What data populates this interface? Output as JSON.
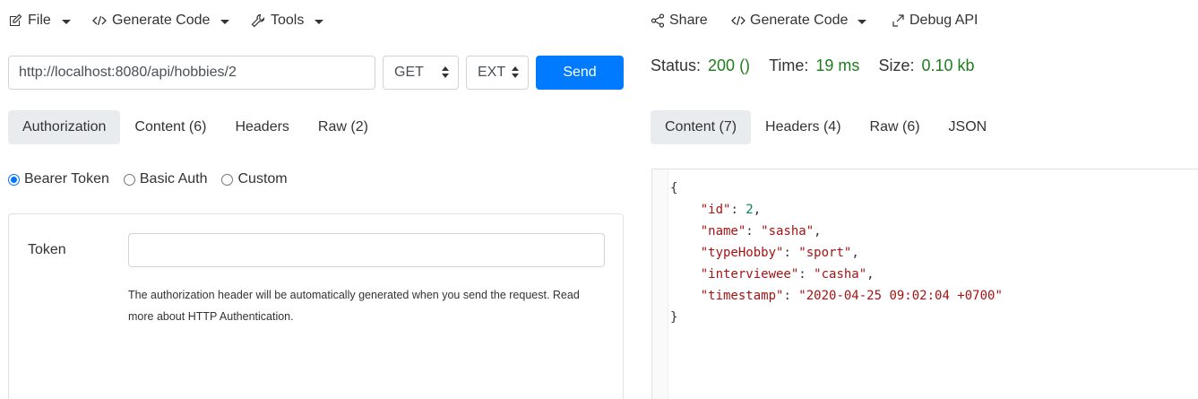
{
  "request_toolbar": {
    "file_label": "File",
    "generate_code_label": "Generate Code",
    "tools_label": "Tools"
  },
  "request": {
    "url": "http://localhost:8080/api/hobbies/2",
    "method": "GET",
    "mode": "EXT",
    "send_label": "Send"
  },
  "request_tabs": [
    {
      "label": "Authorization",
      "active": true
    },
    {
      "label": "Content (6)",
      "active": false
    },
    {
      "label": "Headers",
      "active": false
    },
    {
      "label": "Raw (2)",
      "active": false
    }
  ],
  "auth": {
    "options": [
      "Bearer Token",
      "Basic Auth",
      "Custom"
    ],
    "selected": "Bearer Token",
    "token_label": "Token",
    "token_value": "",
    "help_text": "The authorization header will be automatically generated when you send the request. Read more about HTTP Authentication."
  },
  "response_toolbar": {
    "share_label": "Share",
    "generate_code_label": "Generate Code",
    "debug_label": "Debug API"
  },
  "status": {
    "status_label": "Status:",
    "status_value": "200 ()",
    "time_label": "Time:",
    "time_value": "19 ms",
    "size_label": "Size:",
    "size_value": "0.10 kb"
  },
  "response_tabs": [
    {
      "label": "Content (7)",
      "active": true
    },
    {
      "label": "Headers (4)",
      "active": false
    },
    {
      "label": "Raw (6)",
      "active": false
    },
    {
      "label": "JSON",
      "active": false
    }
  ],
  "response_json": {
    "id_key": "\"id\"",
    "id_val": "2",
    "name_key": "\"name\"",
    "name_val": "\"sasha\"",
    "type_key": "\"typeHobby\"",
    "type_val": "\"sport\"",
    "interviewee_key": "\"interviewee\"",
    "interviewee_val": "\"casha\"",
    "timestamp_key": "\"timestamp\"",
    "timestamp_val": "\"2020-04-25 09:02:04 +0700\""
  },
  "colors": {
    "primary": "#007bff",
    "success_text": "#1e7e1e",
    "active_tab_bg": "#e9ecef"
  }
}
